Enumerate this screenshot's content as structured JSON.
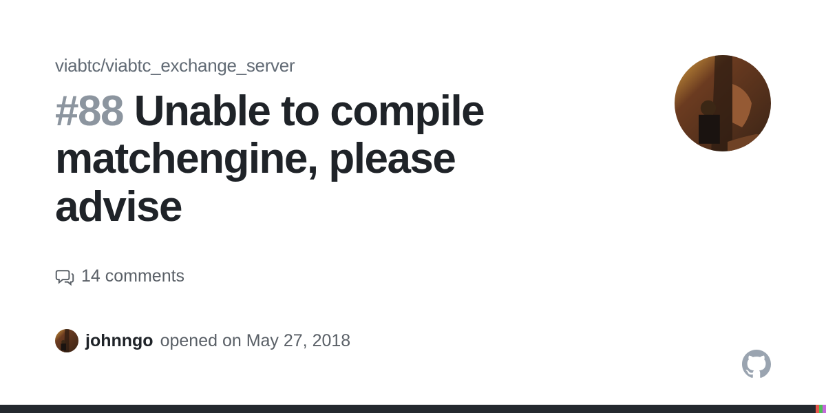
{
  "repo": "viabtc/viabtc_exchange_server",
  "issue": {
    "number": "#88",
    "title": "Unable to compile matchengine, please advise"
  },
  "comments": {
    "count_text": "14 comments"
  },
  "author": {
    "username": "johnngo",
    "opened_text": "opened on May 27, 2018"
  },
  "bars": {
    "colors": [
      "#e7554a",
      "#4dbd56",
      "#c467da"
    ]
  }
}
